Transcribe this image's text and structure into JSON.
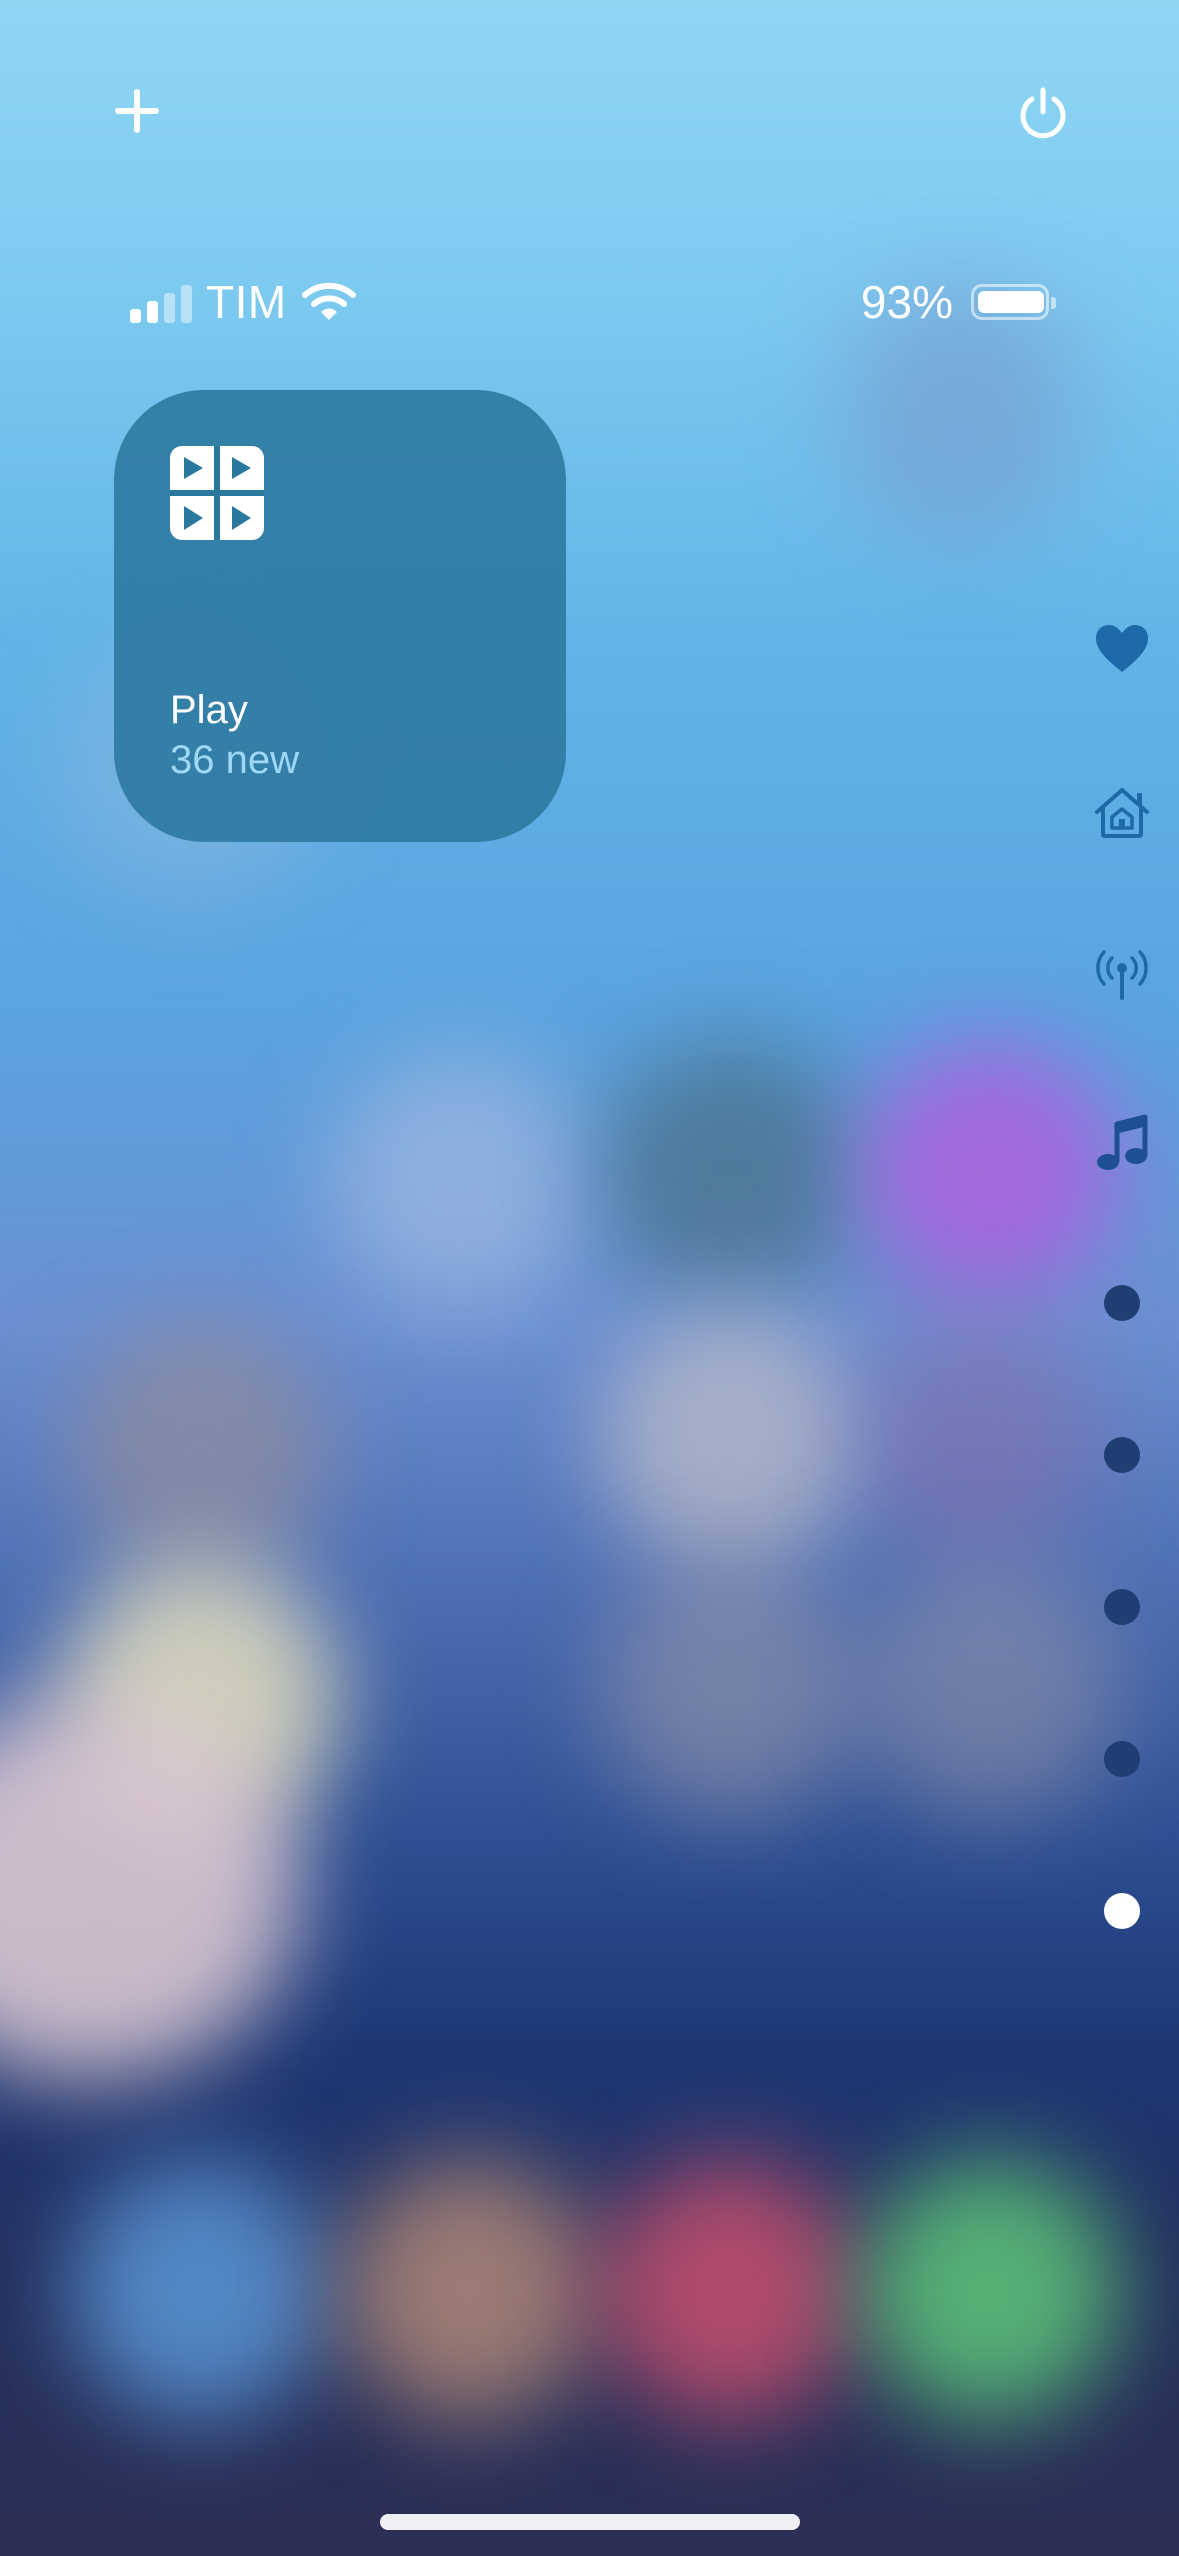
{
  "top_bar": {
    "add_icon": "plus-icon",
    "power_icon": "power-icon"
  },
  "status_bar": {
    "carrier": "TIM",
    "battery_percent": "93%",
    "battery_level": 0.93,
    "signal_bars_active": 2,
    "signal_bars_total": 4
  },
  "widget": {
    "title": "Play",
    "subtitle": "36 new",
    "icon": "video-grid-icon",
    "background_color": "#2b789e"
  },
  "page_index": {
    "icons": [
      "heart-icon",
      "home-icon",
      "broadcast-icon",
      "music-icon"
    ],
    "dot_count": 5,
    "active_dot": 5,
    "active_color": "#ffffff",
    "inactive_color": "#1f3e73"
  }
}
